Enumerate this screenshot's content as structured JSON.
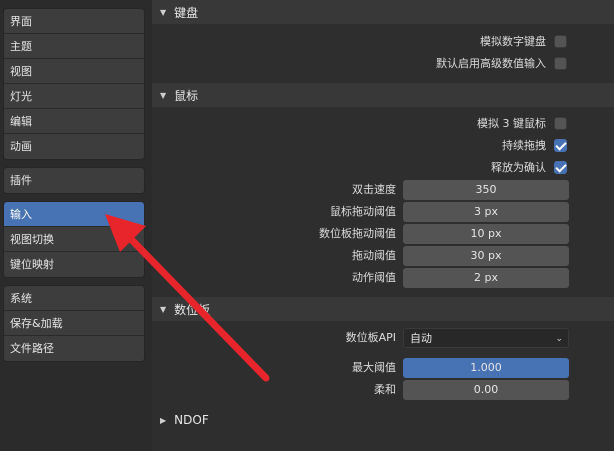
{
  "sidebar": {
    "groups": [
      {
        "items": [
          "界面",
          "主题",
          "视图",
          "灯光",
          "编辑",
          "动画"
        ]
      },
      {
        "items": [
          "插件"
        ]
      },
      {
        "items": [
          "输入",
          "视图切换",
          "键位映射"
        ]
      },
      {
        "items": [
          "系统",
          "保存&加载",
          "文件路径"
        ]
      }
    ],
    "active_item": "输入"
  },
  "sections": {
    "keyboard": {
      "title": "键盘",
      "emulate_numpad_label": "模拟数字键盘",
      "emulate_numpad": false,
      "default_adv_input_label": "默认启用高级数值输入",
      "default_adv_input": false
    },
    "mouse": {
      "title": "鼠标",
      "emulate_3btn_label": "模拟 3 键鼠标",
      "emulate_3btn": false,
      "continuous_grab_label": "持续拖拽",
      "continuous_grab": true,
      "release_confirm_label": "释放为确认",
      "release_confirm": true,
      "double_click_label": "双击速度",
      "double_click_value": "350",
      "mouse_drag_label": "鼠标拖动阈值",
      "mouse_drag_value": "3 px",
      "tablet_drag_label": "数位板拖动阈值",
      "tablet_drag_value": "10 px",
      "drag_threshold_label": "拖动阈值",
      "drag_threshold_value": "30 px",
      "motion_threshold_label": "动作阈值",
      "motion_threshold_value": "2 px"
    },
    "tablet": {
      "title": "数位板",
      "api_label": "数位板API",
      "api_value": "自动",
      "max_threshold_label": "最大阈值",
      "max_threshold_value": "1.000",
      "max_threshold_fraction": 1.0,
      "softness_label": "柔和",
      "softness_value": "0.00",
      "softness_fraction": 0.0
    },
    "ndof": {
      "title": "NDOF"
    }
  },
  "colors": {
    "accent": "#4772b3",
    "arrow": "#e8252b"
  },
  "icons": {
    "expanded": "▼",
    "collapsed": "▶",
    "dropdown": "chevron-down-icon"
  }
}
